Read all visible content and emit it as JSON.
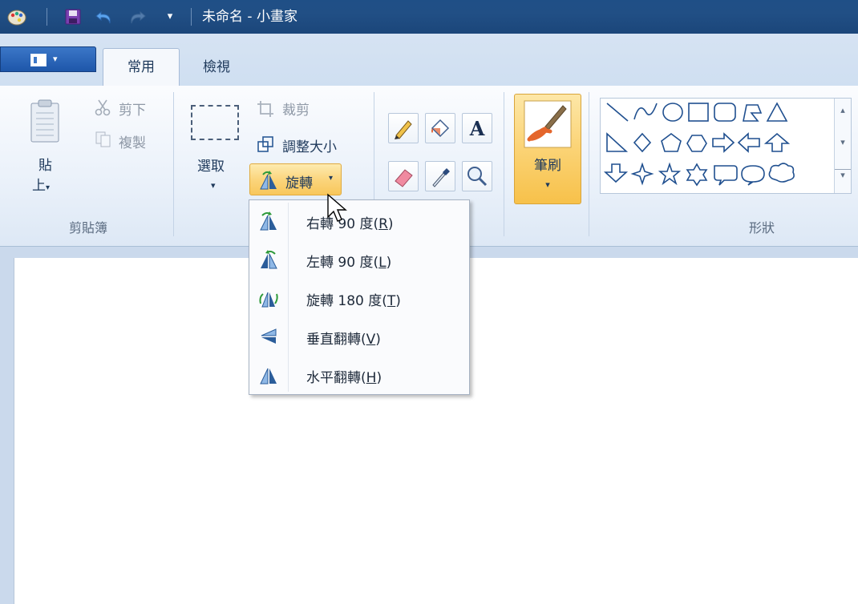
{
  "window": {
    "title": "未命名 - 小畫家",
    "qa_customize": "▾"
  },
  "tabs": [
    {
      "label": "常用",
      "active": true
    },
    {
      "label": "檢視",
      "active": false
    }
  ],
  "app_menu": {
    "arrow": "▾"
  },
  "clipboard": {
    "paste_label_1": "貼",
    "paste_label_2": "上",
    "paste_arrow": "▾",
    "cut_label": "剪下",
    "copy_label": "複製",
    "group_label": "剪貼簿"
  },
  "image": {
    "select_label": "選取",
    "select_arrow": "▾",
    "crop_label": "裁剪",
    "resize_label": "調整大小",
    "rotate_label": "旋轉",
    "rotate_arrow": "▾"
  },
  "tools": {
    "brushes_label": "筆刷",
    "brushes_arrow": "▾"
  },
  "shapes": {
    "group_label": "形狀",
    "scroll_up": "▴",
    "scroll_down": "▾",
    "scroll_more": "▾"
  },
  "rotate_menu": {
    "items": [
      {
        "text": "右轉 90 度(",
        "key": "R",
        "end": ")"
      },
      {
        "text": "左轉 90 度(",
        "key": "L",
        "end": ")"
      },
      {
        "text": "旋轉 180 度(",
        "key": "T",
        "end": ")"
      },
      {
        "text": "垂直翻轉(",
        "key": "V",
        "end": ")"
      },
      {
        "text": "水平翻轉(",
        "key": "H",
        "end": ")"
      }
    ]
  },
  "colors": {
    "titlebar": "#1f4f86",
    "ribbon": "#f5f8fc",
    "highlight": "#fbd375",
    "canvas": "#ffffff",
    "workspace": "#cad9ec"
  }
}
